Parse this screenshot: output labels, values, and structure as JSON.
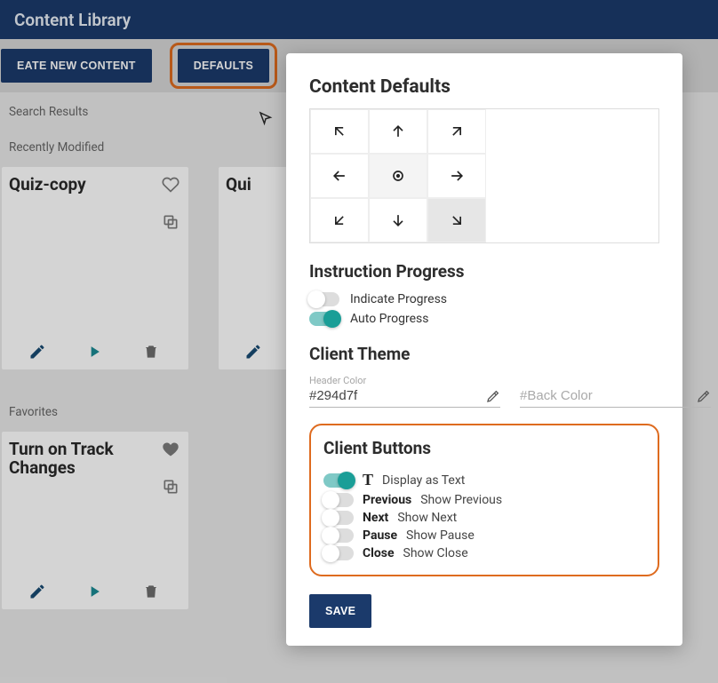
{
  "header": {
    "title": "Content Library"
  },
  "toolbar": {
    "create_label": "EATE NEW CONTENT",
    "defaults_label": "DEFAULTS"
  },
  "labels": {
    "search_results": "Search Results",
    "recently_modified": "Recently Modified",
    "favorites": "Favorites"
  },
  "cards": {
    "recent": [
      {
        "title": "Quiz-copy"
      },
      {
        "title": "Qui"
      }
    ],
    "favorites": [
      {
        "title": "Turn on Track Changes"
      }
    ]
  },
  "modal": {
    "title": "Content Defaults",
    "instruction_progress": {
      "heading": "Instruction Progress",
      "indicate_label": "Indicate Progress",
      "indicate_on": false,
      "auto_label": "Auto Progress",
      "auto_on": true
    },
    "client_theme": {
      "heading": "Client Theme",
      "header_color_label": "Header Color",
      "header_color_value": "#294d7f",
      "back_color_placeholder": "#Back Color"
    },
    "client_buttons": {
      "heading": "Client Buttons",
      "rows": [
        {
          "tag": "T",
          "desc": "Display as Text",
          "on": true
        },
        {
          "tag": "Previous",
          "desc": "Show Previous",
          "on": false
        },
        {
          "tag": "Next",
          "desc": "Show Next",
          "on": false
        },
        {
          "tag": "Pause",
          "desc": "Show Pause",
          "on": false
        },
        {
          "tag": "Close",
          "desc": "Show Close",
          "on": false
        }
      ]
    },
    "save_label": "SAVE"
  }
}
